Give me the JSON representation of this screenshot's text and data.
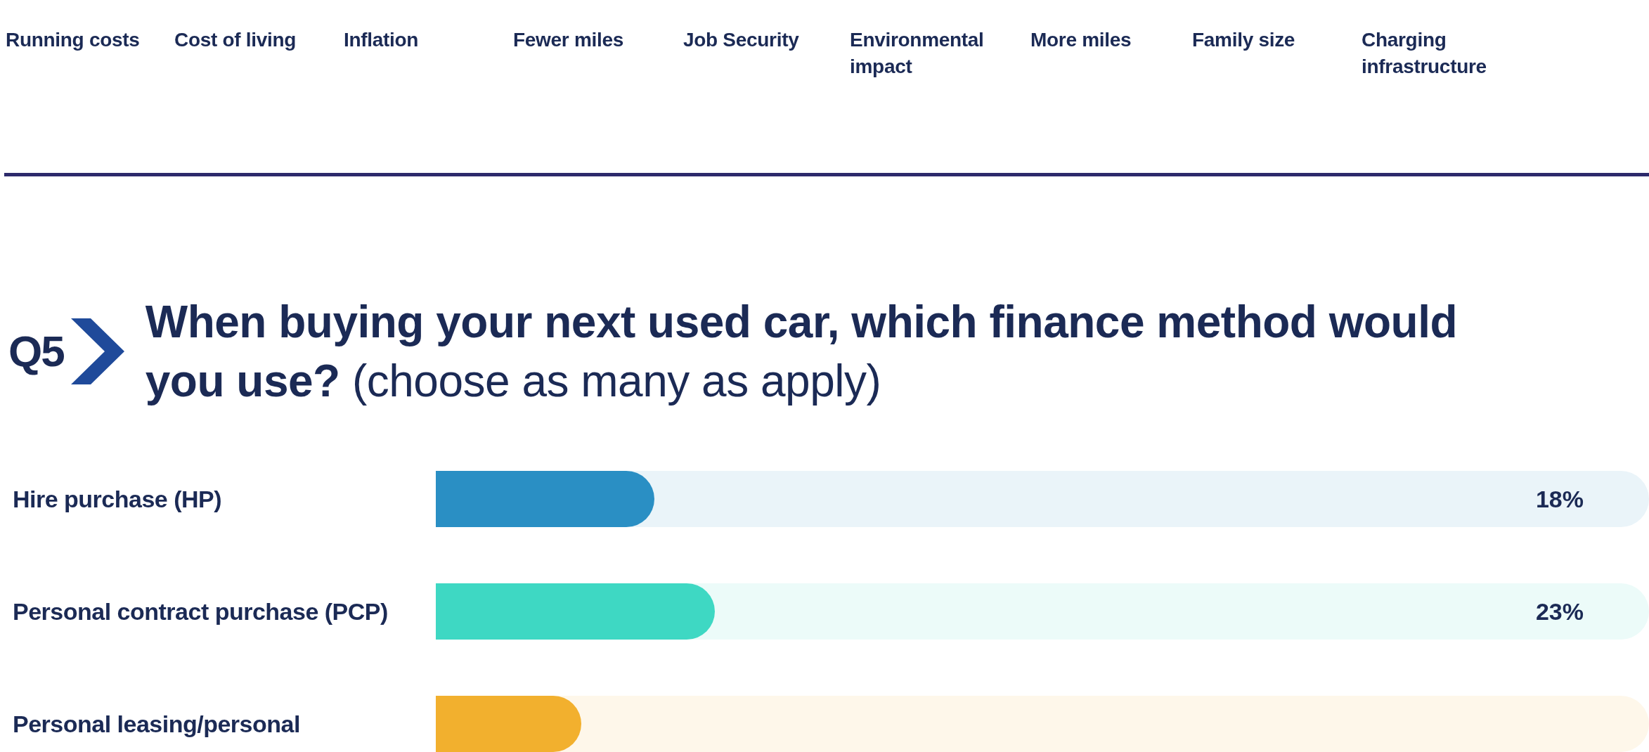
{
  "factors": [
    {
      "label": "Running costs"
    },
    {
      "label": "Cost of living"
    },
    {
      "label": "Inflation"
    },
    {
      "label": "Fewer miles"
    },
    {
      "label": "Job Security"
    },
    {
      "label": "Environmental impact"
    },
    {
      "label": "More miles"
    },
    {
      "label": "Family size"
    },
    {
      "label": "Charging infrastructure"
    }
  ],
  "question": {
    "number": "Q5",
    "title": "**When buying your next used car, which finance method would you use?** (choose as many as apply)"
  },
  "options": [
    {
      "label": "Hire purchase (HP)",
      "level": 0.18,
      "reading": "18%",
      "color": "#2a8fc4"
    },
    {
      "label": "Personal contract purchase (PCP)",
      "level": 0.23,
      "reading": "23%",
      "color": "#3ed8c3"
    },
    {
      "label": "Personal leasing/personal",
      "level": 0.12,
      "color": "#f2b02e"
    }
  ]
}
